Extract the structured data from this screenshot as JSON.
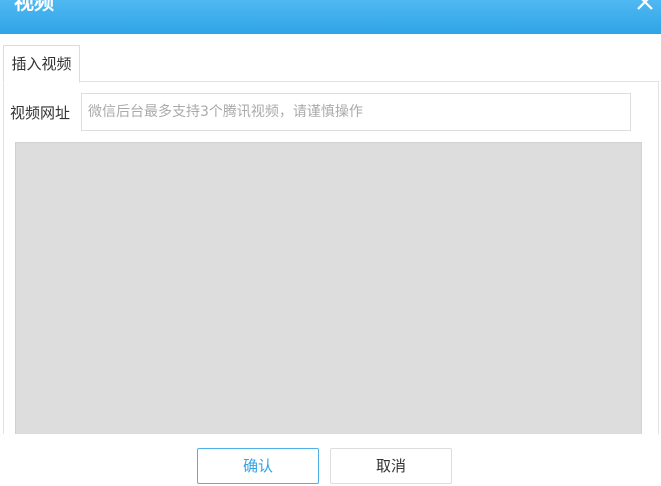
{
  "dialog": {
    "title": "视频",
    "close_icon": "close-icon",
    "accent_color": "#2fa4e7"
  },
  "tabs": [
    {
      "label": "插入视频",
      "active": true
    }
  ],
  "form": {
    "url_label": "视频网址",
    "url_value": "",
    "url_placeholder": "微信后台最多支持3个腾讯视频，请谨慎操作"
  },
  "footer": {
    "confirm_label": "确认",
    "cancel_label": "取消"
  }
}
